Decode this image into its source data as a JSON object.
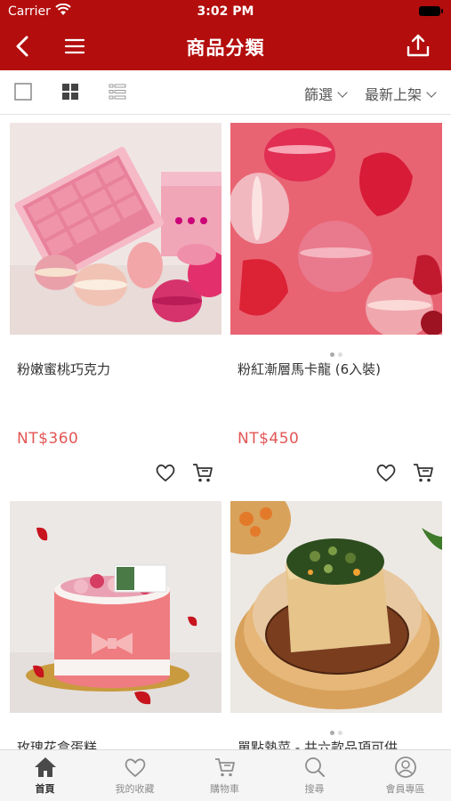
{
  "status_bar": {
    "carrier": "Carrier",
    "time": "3:02 PM"
  },
  "nav": {
    "title": "商品分類"
  },
  "toolbar": {
    "filter_label": "篩選",
    "sort_label": "最新上架"
  },
  "products": [
    {
      "name": "粉嫩蜜桃巧克力",
      "price": "NT$360"
    },
    {
      "name": "粉紅漸層馬卡龍 (6入裝)",
      "price": "NT$450"
    },
    {
      "name": "玫瑰花盒蛋糕",
      "price": ""
    },
    {
      "name": "單點熱菜 - 共六款品項可供",
      "price": ""
    }
  ],
  "tabs": [
    {
      "label": "首頁",
      "icon": "home-icon",
      "active": true
    },
    {
      "label": "我的收藏",
      "icon": "heart-icon"
    },
    {
      "label": "購物車",
      "icon": "cart-icon"
    },
    {
      "label": "搜尋",
      "icon": "search-icon"
    },
    {
      "label": "會員專區",
      "icon": "user-icon"
    }
  ],
  "colors": {
    "brand": "#b30d0d",
    "price": "#e25655"
  }
}
